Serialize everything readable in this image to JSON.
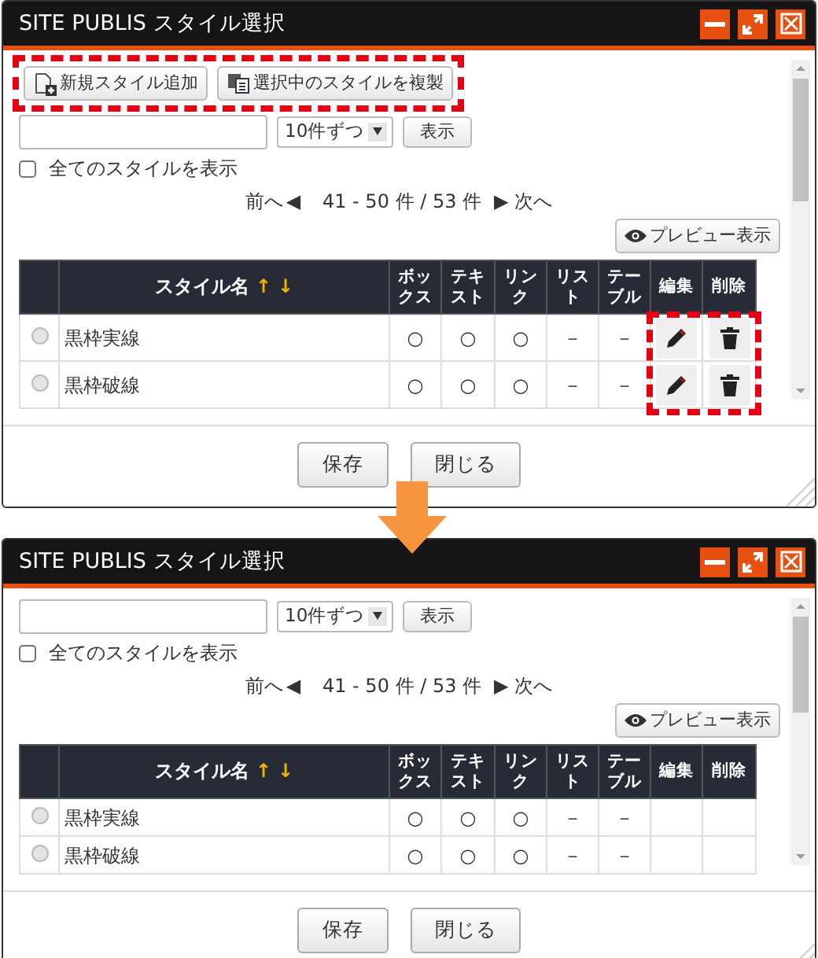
{
  "dialogs": [
    {
      "title": "SITE PUBLIS スタイル選択",
      "toolbar": {
        "highlighted": true,
        "buttons": [
          {
            "label": "新規スタイル追加",
            "kind": "add"
          },
          {
            "label": "選択中のスタイルを複製",
            "kind": "copy"
          }
        ]
      },
      "search": {
        "per_page": "10件ずつ",
        "submit": "表示"
      },
      "show_all": {
        "label": "全てのスタイルを表示",
        "checked": false
      },
      "pager": {
        "prev": "前へ",
        "prev_icon": "◀",
        "range": "41 - 50 件 / 53 件",
        "next_icon": "▶",
        "next": "次へ"
      },
      "preview": "プレビュー表示",
      "columns": [
        {
          "label": "スタイル名",
          "sort": [
            "↑",
            "↓"
          ]
        },
        {
          "label": "ボックス"
        },
        {
          "label": "テキスト"
        },
        {
          "label": "リンク"
        },
        {
          "label": "リスト"
        },
        {
          "label": "テーブル"
        },
        {
          "label": "編集"
        },
        {
          "label": "削除"
        }
      ],
      "rows": [
        {
          "selected": false,
          "name": "黒枠実線",
          "marks": [
            "○",
            "○",
            "○",
            "－",
            "－"
          ],
          "actions": true
        },
        {
          "selected": false,
          "name": "黒枠破線",
          "marks": [
            "○",
            "○",
            "○",
            "－",
            "－"
          ],
          "actions": true
        }
      ],
      "actions_highlighted": true,
      "footer": [
        "保存",
        "閉じる"
      ]
    },
    {
      "title": "SITE PUBLIS スタイル選択",
      "search": {
        "per_page": "10件ずつ",
        "submit": "表示"
      },
      "show_all": {
        "label": "全てのスタイルを表示",
        "checked": false
      },
      "pager": {
        "prev": "前へ",
        "prev_icon": "◀",
        "range": "41 - 50 件 / 53 件",
        "next_icon": "▶",
        "next": "次へ"
      },
      "preview": "プレビュー表示",
      "columns": [
        {
          "label": "スタイル名",
          "sort": [
            "↑",
            "↓"
          ]
        },
        {
          "label": "ボックス"
        },
        {
          "label": "テキスト"
        },
        {
          "label": "リンク"
        },
        {
          "label": "リスト"
        },
        {
          "label": "テーブル"
        },
        {
          "label": "編集"
        },
        {
          "label": "削除"
        }
      ],
      "rows": [
        {
          "selected": false,
          "name": "黒枠実線",
          "marks": [
            "○",
            "○",
            "○",
            "－",
            "－"
          ],
          "actions": false
        },
        {
          "selected": false,
          "name": "黒枠破線",
          "marks": [
            "○",
            "○",
            "○",
            "－",
            "－"
          ],
          "actions": false
        }
      ],
      "actions_highlighted": false,
      "footer": [
        "保存",
        "閉じる"
      ]
    }
  ]
}
